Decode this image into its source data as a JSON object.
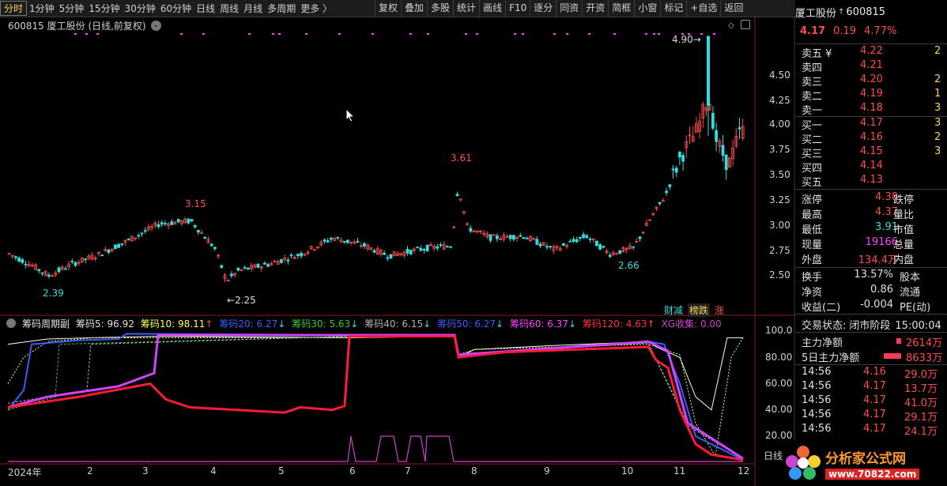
{
  "toolbar": {
    "periods": [
      "分时",
      "1分钟",
      "5分钟",
      "15分钟",
      "30分钟",
      "60分钟",
      "日线",
      "周线",
      "月线",
      "多周期",
      "更多 〉"
    ],
    "active_period": "分时",
    "buttons": [
      "复权",
      "叠加",
      "多股",
      "统计",
      "画线",
      "F10",
      "逐分",
      "同资",
      "开资",
      "简框",
      "小窗",
      "标记",
      "+自选",
      "返回"
    ]
  },
  "stock": {
    "name": "厦工股份",
    "code": "600815",
    "price": "4.17",
    "change": "0.19",
    "change_pct": "4.77%"
  },
  "chart_header": "600815  厦工股份 (日线,前复权)",
  "price_axis": [
    "4.50",
    "4.25",
    "4.00",
    "3.75",
    "3.50",
    "3.25",
    "3.00",
    "2.75",
    "2.50"
  ],
  "annotations": {
    "high": "4.90",
    "peak1": "3.15",
    "peak2": "3.61",
    "low1": "2.39",
    "low2": "2.25",
    "low3": "2.66"
  },
  "tags": [
    "财减",
    "榜跌",
    "涨"
  ],
  "indicator": {
    "name": "筹码周期副",
    "items": [
      {
        "label": "筹码5: 96.92",
        "color": "#e0e0e0"
      },
      {
        "label": "筹码10: 98.11",
        "color": "#ffff55",
        "arrow": "↑"
      },
      {
        "label": "筹码20: 6.27",
        "color": "#3a5cff",
        "arrow": "↓"
      },
      {
        "label": "筹码30: 5.63",
        "color": "#33cc33",
        "arrow": "↓"
      },
      {
        "label": "筹码40: 6.15",
        "color": "#b0b0b0",
        "arrow": "↓"
      },
      {
        "label": "筹码50: 6.27",
        "color": "#3a5cff",
        "arrow": "↓"
      },
      {
        "label": "筹码60: 6.37",
        "color": "#ff44ff",
        "arrow": "↓"
      },
      {
        "label": "筹码120: 4.63",
        "color": "#ff3333",
        "arrow": "↑"
      },
      {
        "label": "XG收集: 0.00",
        "color": "#cc44cc"
      }
    ],
    "axis": [
      "100.0",
      "80.00",
      "60.00",
      "40.00",
      "20.00"
    ]
  },
  "time_axis": [
    "2024年",
    "2",
    "3",
    "4",
    "5",
    "6",
    "7",
    "8",
    "9",
    "10",
    "11",
    "12"
  ],
  "bottom_tab": "日线",
  "order_book": {
    "sell": [
      {
        "label": "卖五 ¥",
        "price": "4.22",
        "vol": "2"
      },
      {
        "label": "卖四",
        "price": "4.21",
        "vol": ""
      },
      {
        "label": "卖三",
        "price": "4.20",
        "vol": "2"
      },
      {
        "label": "卖二",
        "price": "4.19",
        "vol": "1"
      },
      {
        "label": "卖一",
        "price": "4.18",
        "vol": "3"
      }
    ],
    "buy": [
      {
        "label": "买一",
        "price": "4.17",
        "vol": "3"
      },
      {
        "label": "买二",
        "price": "4.16",
        "vol": "2"
      },
      {
        "label": "买三",
        "price": "4.15",
        "vol": "3"
      },
      {
        "label": "买四",
        "price": "4.14",
        "vol": ""
      },
      {
        "label": "买五",
        "price": "4.13",
        "vol": ""
      }
    ]
  },
  "stats": [
    {
      "l1": "涨停",
      "v1": "4.38",
      "c1": "#ff4c4c",
      "l2": "跌停"
    },
    {
      "l1": "最高",
      "v1": "4.37",
      "c1": "#ff4c4c",
      "l2": "量比"
    },
    {
      "l1": "最低",
      "v1": "3.91",
      "c1": "#33dddd",
      "l2": "市值"
    },
    {
      "l1": "现量",
      "v1": "19166",
      "c1": "#ff44ff",
      "l2": "总量"
    },
    {
      "l1": "外盘",
      "v1": "134.4万",
      "c1": "#ff4c4c",
      "l2": "内盘"
    }
  ],
  "stats2": [
    {
      "l1": "换手",
      "v1": "13.57%",
      "l2": "股本"
    },
    {
      "l1": "净资",
      "v1": "0.86",
      "l2": "流通"
    },
    {
      "l1": "收益(二)",
      "v1": "-0.004",
      "l2": "PE(动)"
    }
  ],
  "trade_status": {
    "label": "交易状态:",
    "status": "闭市阶段",
    "time": "15:00:04"
  },
  "flows": [
    {
      "label": "主力净额",
      "value": "2614万"
    },
    {
      "label": "5日主力净额",
      "value": "8633万"
    }
  ],
  "ticks": [
    {
      "time": "14:56",
      "price": "4.16",
      "vol": "29.0万"
    },
    {
      "time": "14:56",
      "price": "4.17",
      "vol": "13.7万"
    },
    {
      "time": "14:56",
      "price": "4.17",
      "vol": "41.0万"
    },
    {
      "time": "14:56",
      "price": "4.17",
      "vol": "29.1万"
    },
    {
      "time": "14:56",
      "price": "4.17",
      "vol": "24.1万"
    }
  ],
  "watermark": {
    "cn": "分析家公式网",
    "url": "www.70822.com"
  },
  "colors": {
    "up": "#ff4c4c",
    "down": "#33dddd",
    "accent": "#ffd24a"
  }
}
